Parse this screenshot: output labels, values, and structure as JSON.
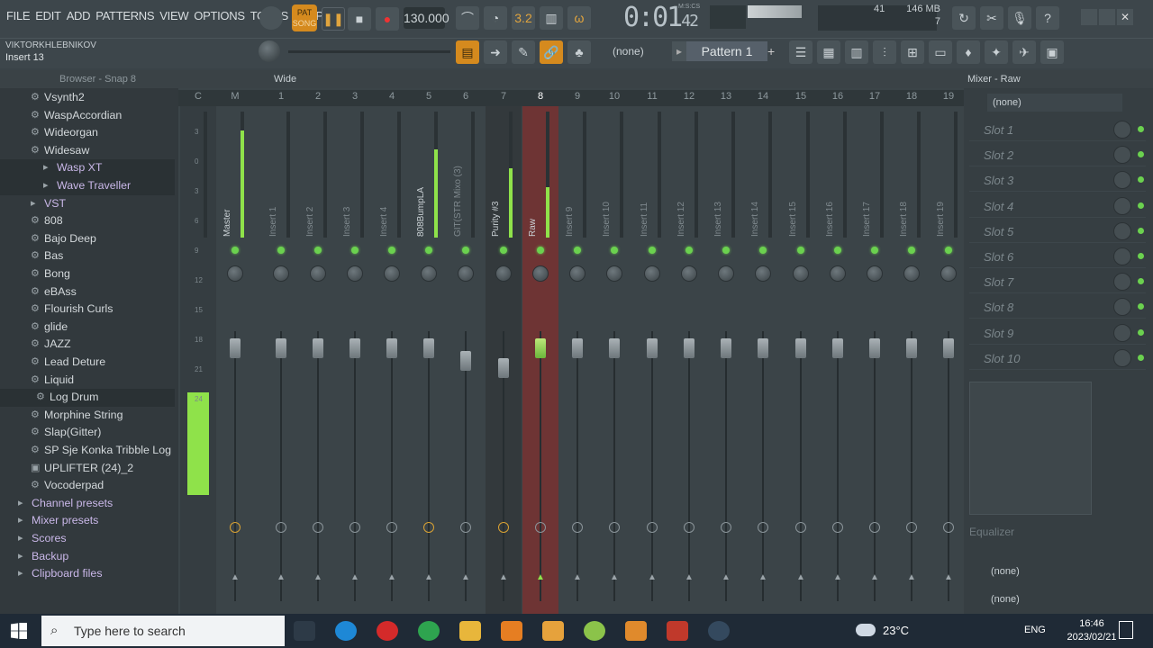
{
  "menu": [
    "FILE",
    "EDIT",
    "ADD",
    "PATTERNS",
    "VIEW",
    "OPTIONS",
    "TOOLS",
    "HELP"
  ],
  "transport": {
    "pat_label": "PAT",
    "song_label": "SONG",
    "tempo": "130.000",
    "time_main": "0:01",
    "time_small": "42",
    "time_unit": "M:S:CS"
  },
  "monitor": {
    "cpu": "41",
    "memory": "146 MB",
    "polyphony": "7"
  },
  "hint": {
    "line1": "VIKTORKHLEBNIKOV",
    "line2": "Insert 13"
  },
  "pattern": {
    "none_label": "(none)",
    "current": "Pattern 1",
    "add": "+"
  },
  "browser": {
    "title": "Browser - Snap 8",
    "items": [
      {
        "label": "Vsynth2",
        "type": "gear"
      },
      {
        "label": "WaspAccordian",
        "type": "gear"
      },
      {
        "label": "Wideorgan",
        "type": "gear"
      },
      {
        "label": "Widesaw",
        "type": "gear"
      },
      {
        "label": "Wasp XT",
        "type": "folder-plugin"
      },
      {
        "label": "Wave Traveller",
        "type": "folder-plugin"
      },
      {
        "label": "VST",
        "type": "folder"
      },
      {
        "label": "808",
        "type": "gear"
      },
      {
        "label": "Bajo Deep",
        "type": "gear"
      },
      {
        "label": "Bas",
        "type": "gear"
      },
      {
        "label": "Bong",
        "type": "gear"
      },
      {
        "label": "eBAss",
        "type": "gear"
      },
      {
        "label": "Flourish Curls",
        "type": "gear"
      },
      {
        "label": "glide",
        "type": "gear"
      },
      {
        "label": "JAZZ",
        "type": "gear"
      },
      {
        "label": "Lead Deture",
        "type": "gear"
      },
      {
        "label": "Liquid",
        "type": "gear"
      },
      {
        "label": "Log Drum",
        "type": "gear"
      },
      {
        "label": "Morphine String",
        "type": "gear"
      },
      {
        "label": "Slap(Gitter)",
        "type": "gear"
      },
      {
        "label": "SP Sje Konka Tribble Log",
        "type": "gear"
      },
      {
        "label": "UPLIFTER (24)_2",
        "type": "file"
      },
      {
        "label": "Vocoderpad",
        "type": "gear"
      },
      {
        "label": "Channel presets",
        "type": "section"
      },
      {
        "label": "Mixer presets",
        "type": "section"
      },
      {
        "label": "Scores",
        "type": "section"
      },
      {
        "label": "Backup",
        "type": "section"
      },
      {
        "label": "Clipboard files",
        "type": "section"
      }
    ]
  },
  "mixer": {
    "view": "Wide",
    "strips": [
      {
        "num": "C",
        "label": "",
        "level": 0
      },
      {
        "num": "M",
        "label": "Master",
        "level": 0.85
      },
      {
        "num": "1",
        "label": "Insert 1",
        "level": 0
      },
      {
        "num": "2",
        "label": "Insert 2",
        "level": 0
      },
      {
        "num": "3",
        "label": "Insert 3",
        "level": 0
      },
      {
        "num": "4",
        "label": "Insert 4",
        "level": 0
      },
      {
        "num": "5",
        "label": "808BumpLA",
        "level": 0.7
      },
      {
        "num": "6",
        "label": "GIT(STR Mixo (3)",
        "level": 0
      },
      {
        "num": "7",
        "label": "Purity #3",
        "level": 0.55
      },
      {
        "num": "8",
        "label": "Raw",
        "level": 0.4
      },
      {
        "num": "9",
        "label": "Insert 9",
        "level": 0
      },
      {
        "num": "10",
        "label": "Insert 10",
        "level": 0
      },
      {
        "num": "11",
        "label": "Insert 11",
        "level": 0
      },
      {
        "num": "12",
        "label": "Insert 12",
        "level": 0
      },
      {
        "num": "13",
        "label": "Insert 13",
        "level": 0
      },
      {
        "num": "14",
        "label": "Insert 14",
        "level": 0
      },
      {
        "num": "15",
        "label": "Insert 15",
        "level": 0
      },
      {
        "num": "16",
        "label": "Insert 16",
        "level": 0
      },
      {
        "num": "17",
        "label": "Insert 17",
        "level": 0
      },
      {
        "num": "18",
        "label": "Insert 18",
        "level": 0
      },
      {
        "num": "19",
        "label": "Insert 19",
        "level": 0
      }
    ],
    "db_marks": [
      "3",
      "0",
      "3",
      "6",
      "9",
      "12",
      "15",
      "18",
      "21",
      "24"
    ]
  },
  "right_panel": {
    "title": "Mixer - Raw",
    "preset": "(none)",
    "slots": [
      "Slot 1",
      "Slot 2",
      "Slot 3",
      "Slot 4",
      "Slot 5",
      "Slot 6",
      "Slot 7",
      "Slot 8",
      "Slot 9",
      "Slot 10"
    ],
    "eq_label": "Equalizer",
    "in_none": "(none)",
    "out_none": "(none)"
  },
  "taskbar": {
    "search_placeholder": "Type here to search",
    "temperature": "23°C",
    "language": "ENG",
    "time": "16:46",
    "date": "2023/02/21"
  },
  "colors": {
    "accent_orange": "#d58a1e",
    "meter_green": "#8fe24a",
    "selected_strip": "#7a3535",
    "led_green": "#6bd14f"
  }
}
